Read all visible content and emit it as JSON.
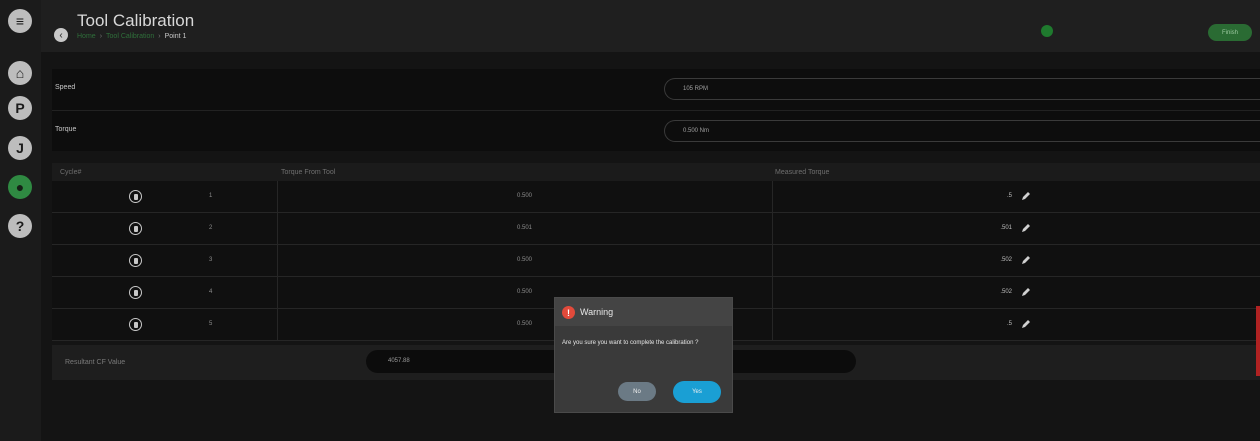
{
  "header": {
    "title": "Tool Calibration",
    "breadcrumb": [
      "Home",
      "Tool Calibration",
      "Point 1"
    ],
    "finish_label": "Finish"
  },
  "sidebar": {
    "items": [
      {
        "icon": "menu-icon",
        "glyph": "≡"
      },
      {
        "icon": "home-icon",
        "glyph": "⌂"
      },
      {
        "icon": "p-icon",
        "glyph": "P"
      },
      {
        "icon": "j-icon",
        "glyph": "J"
      },
      {
        "icon": "user-icon",
        "glyph": "●"
      },
      {
        "icon": "help-icon",
        "glyph": "?"
      }
    ]
  },
  "settings": {
    "speed_label": "Speed",
    "speed_value": "105 RPM",
    "torque_label": "Torque",
    "torque_value": "0.500 Nm"
  },
  "table": {
    "headers": [
      "Cycle#",
      "Torque From Tool",
      "Measured Torque"
    ],
    "rows": [
      {
        "cycle": "1",
        "torque_from_tool": "0.500",
        "measured": ".5"
      },
      {
        "cycle": "2",
        "torque_from_tool": "0.501",
        "measured": ".501"
      },
      {
        "cycle": "3",
        "torque_from_tool": "0.500",
        "measured": ".502"
      },
      {
        "cycle": "4",
        "torque_from_tool": "0.500",
        "measured": ".502"
      },
      {
        "cycle": "5",
        "torque_from_tool": "0.500",
        "measured": ".5"
      }
    ]
  },
  "result": {
    "label": "Resultant CF Value",
    "value": "4057.88"
  },
  "dialog": {
    "title": "Warning",
    "message": "Are you sure you want to complete the calibration ?",
    "no_label": "No",
    "yes_label": "Yes"
  },
  "colors": {
    "accent_green": "#2f8a42",
    "warning_red": "#e24a3b",
    "yes_blue": "#1a9fd4"
  }
}
